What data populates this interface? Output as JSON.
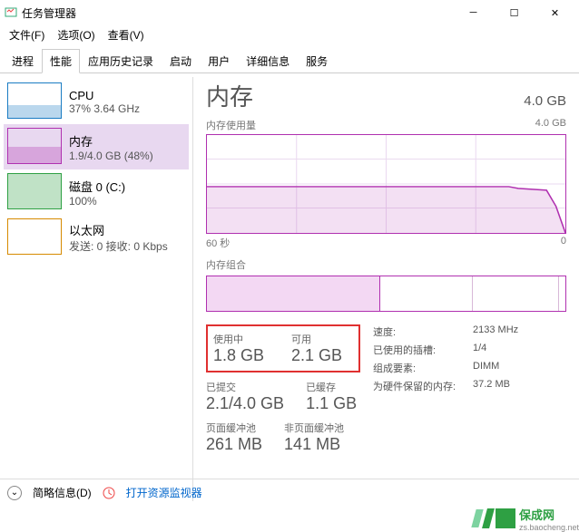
{
  "window": {
    "title": "任务管理器"
  },
  "menu": {
    "file": "文件(F)",
    "options": "选项(O)",
    "view": "查看(V)"
  },
  "tabs": [
    "进程",
    "性能",
    "应用历史记录",
    "启动",
    "用户",
    "详细信息",
    "服务"
  ],
  "sidebar": [
    {
      "name": "CPU",
      "sub": "37% 3.64 GHz"
    },
    {
      "name": "内存",
      "sub": "1.9/4.0 GB (48%)"
    },
    {
      "name": "磁盘 0 (C:)",
      "sub": "100%"
    },
    {
      "name": "以太网",
      "sub": "发送: 0 接收: 0 Kbps"
    }
  ],
  "main": {
    "title": "内存",
    "total": "4.0 GB",
    "usage_lbl": "内存使用量",
    "usage_max": "4.0 GB",
    "usage_time": "60 秒",
    "usage_zero": "0",
    "combo_lbl": "内存组合",
    "hl": {
      "used_lbl": "使用中",
      "used": "1.8 GB",
      "avail_lbl": "可用",
      "avail": "2.1 GB"
    },
    "committed_lbl": "已提交",
    "committed": "2.1/4.0 GB",
    "cached_lbl": "已缓存",
    "cached": "1.1 GB",
    "paged_lbl": "页面缓冲池",
    "paged": "261 MB",
    "nonpaged_lbl": "非页面缓冲池",
    "nonpaged": "141 MB",
    "specs": [
      {
        "k": "速度:",
        "v": "2133 MHz"
      },
      {
        "k": "已使用的插槽:",
        "v": "1/4"
      },
      {
        "k": "组成要素:",
        "v": "DIMM"
      },
      {
        "k": "为硬件保留的内存:",
        "v": "37.2 MB"
      }
    ]
  },
  "bottom": {
    "brief": "简略信息(D)",
    "monitor": "打开资源监视器"
  },
  "watermark": {
    "brand": "保成网",
    "url": "zs.baocheng.net"
  },
  "chart_data": {
    "type": "area",
    "title": "内存使用量",
    "x_range": [
      0,
      60
    ],
    "y_range": [
      0,
      4.0
    ],
    "y_unit": "GB",
    "values": [
      1.9,
      1.9,
      1.9,
      1.9,
      1.9,
      1.9,
      0
    ]
  }
}
